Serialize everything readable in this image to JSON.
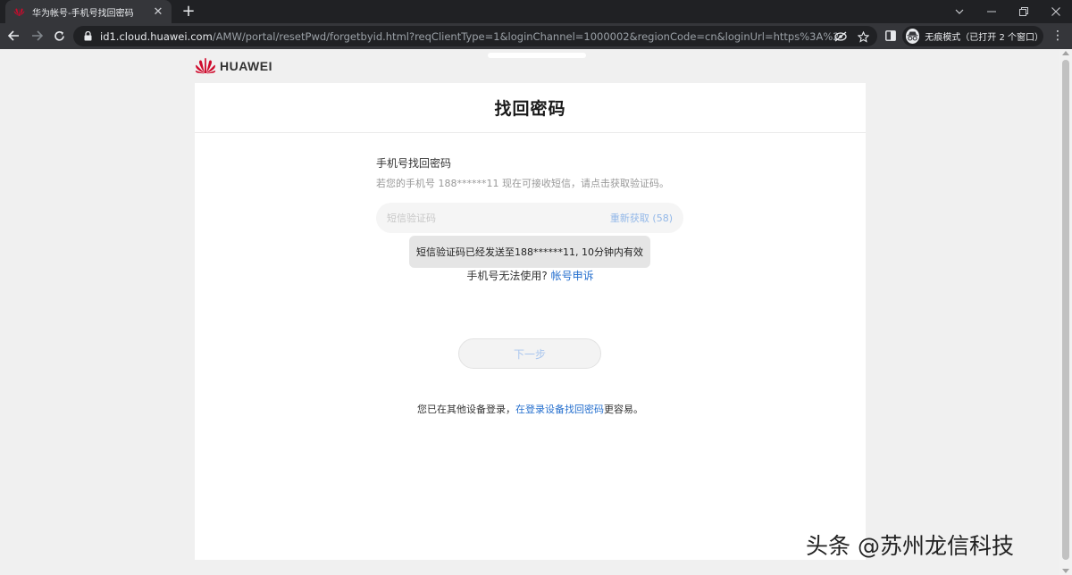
{
  "browser": {
    "tab_title": "华为帐号-手机号找回密码",
    "tab_close": "✕",
    "new_tab": "+",
    "url_host": "id1.cloud.huawei.com",
    "url_rest": "/AMW/portal/resetPwd/forgetbyid.html?reqClientType=1&loginChannel=1000002&regionCode=cn&loginUrl=https%3A%2F%2Fcl...",
    "incognito_label": "无痕模式（已打开 2 个窗口）",
    "menu": "⋮"
  },
  "page": {
    "logo_text": "HUAWEI",
    "title": "找回密码",
    "section_title": "手机号找回密码",
    "section_desc": "若您的手机号 188******11 现在可接收短信，请点击获取验证码。",
    "code_placeholder": "短信验证码",
    "resend_label": "重新获取 (58)",
    "toast": "短信验证码已经发送至188******11, 10分钟内有效",
    "unusable_text": "手机号无法使用?",
    "appeal_link": "帐号申诉",
    "next_button": "下一步",
    "other_device_prefix": "您已在其他设备登录，",
    "other_device_link": "在登录设备找回密码",
    "other_device_suffix": "更容易。"
  },
  "watermark": {
    "text": "头条 @苏州龙信科技"
  },
  "colors": {
    "brand_red": "#cf0a2c",
    "link_blue": "#256fce",
    "disabled_blue": "#a9c6ee"
  }
}
